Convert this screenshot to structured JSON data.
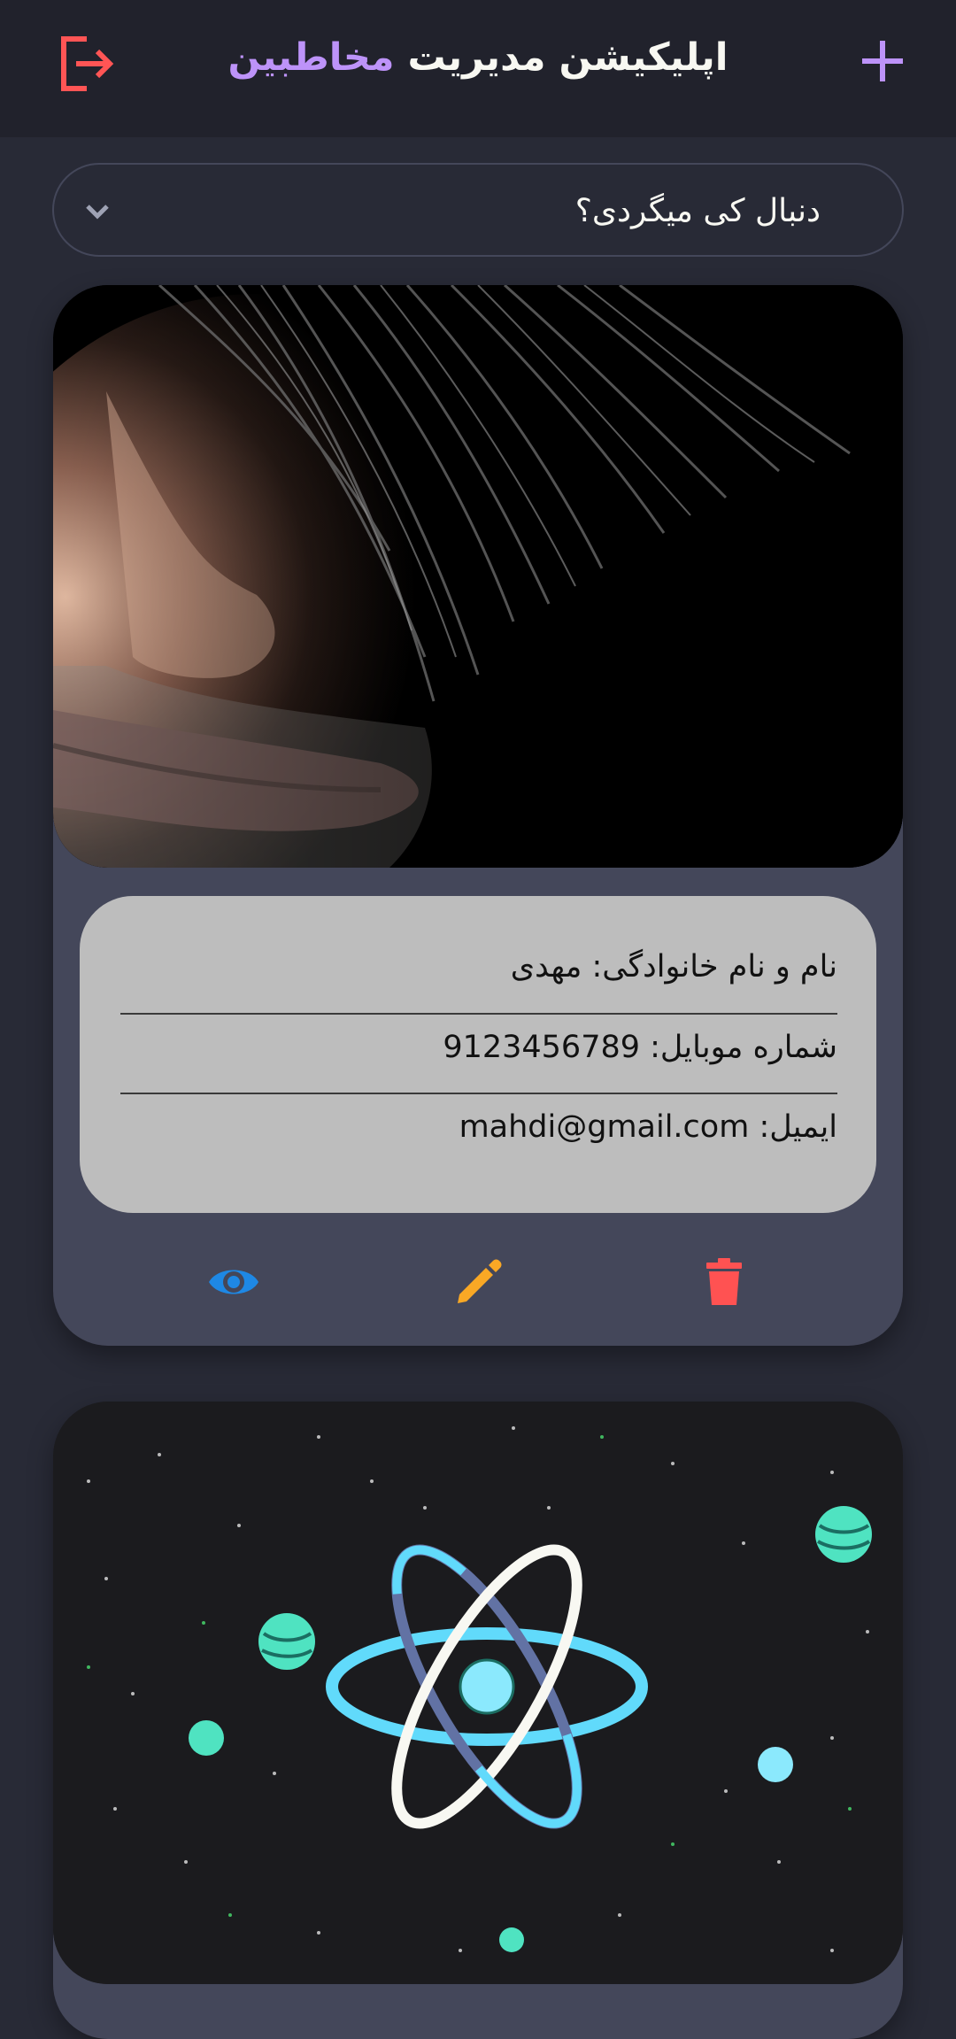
{
  "header": {
    "title_main": "اپلیکیشن مدیریت",
    "title_accent": "مخاطبین",
    "logout_icon": "logout-icon",
    "add_icon": "plus-icon"
  },
  "search": {
    "placeholder": "دنبال کی میگردی؟",
    "icon": "chevron-down-icon"
  },
  "contacts": [
    {
      "fullname": "نام و نام خانوادگی: مهدی",
      "mobile": "شماره موبایل: 9123456789",
      "email": "ایمیل: mahdi@gmail.com",
      "actions": [
        "eye-icon",
        "pencil-icon",
        "trash-icon"
      ]
    }
  ],
  "colors": {
    "background": "#282a36",
    "appbar": "#21222c",
    "card": "#44475a",
    "info_panel": "#bdbdbd",
    "accent_purple": "#bd93f9",
    "logout_red": "#ff5555",
    "view_blue": "#1e88e5",
    "edit_orange": "#f9a825",
    "delete_red": "#ff5252"
  }
}
